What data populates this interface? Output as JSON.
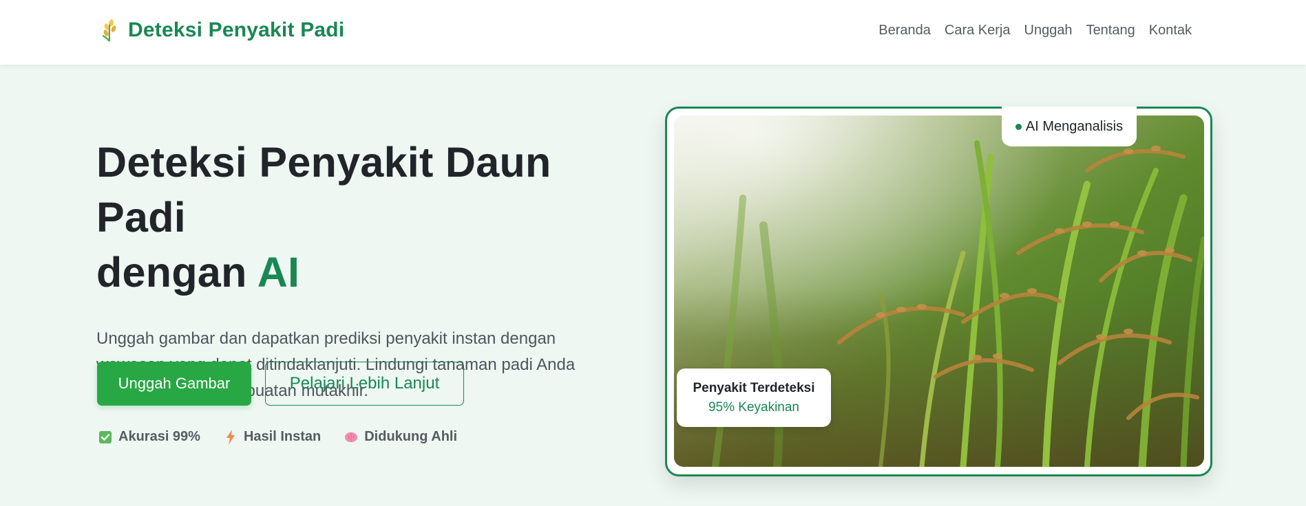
{
  "brand": {
    "name": "Deteksi Penyakit Padi",
    "icon": "rice-stalk-icon"
  },
  "nav": {
    "items": [
      "Beranda",
      "Cara Kerja",
      "Unggah",
      "Tentang",
      "Kontak"
    ]
  },
  "hero": {
    "headline_line1": "Deteksi Penyakit Daun Padi",
    "headline_line2_prefix": "dengan ",
    "headline_accent": "AI",
    "lead": "Unggah gambar dan dapatkan prediksi penyakit instan dengan wawasan yang dapat ditindaklanjuti. Lindungi tanaman padi Anda dengan kecerdasan buatan mutakhir.",
    "primary_button": "Unggah Gambar",
    "secondary_button": "Pelajari Lebih Lanjut",
    "features": [
      {
        "icon": "check-box-icon",
        "label": "Akurasi 99%"
      },
      {
        "icon": "lightning-icon",
        "label": "Hasil Instan"
      },
      {
        "icon": "brain-icon",
        "label": "Didukung Ahli"
      }
    ]
  },
  "card": {
    "status_badge": "AI Menganalisis",
    "detection_title": "Penyakit Terdeteksi",
    "detection_confidence": "95% Keyakinan"
  },
  "colors": {
    "accent": "#198754",
    "primary_button": "#28a745",
    "background": "#eef7f2"
  }
}
